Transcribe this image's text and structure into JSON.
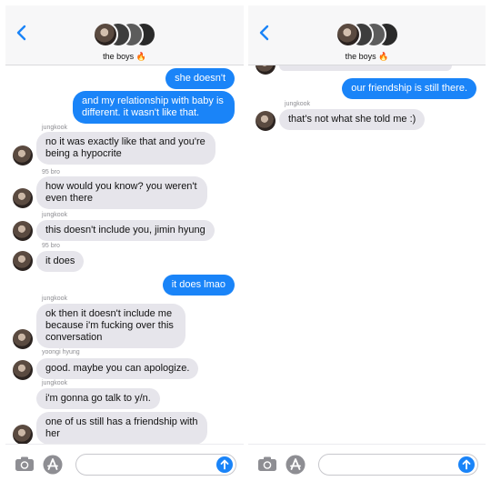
{
  "left": {
    "header": {
      "group_name": "the boys 🔥"
    },
    "messages": [
      {
        "dir": "out",
        "text": "she doesn't"
      },
      {
        "dir": "out",
        "text": "and my relationship with baby is different. it wasn't like that."
      },
      {
        "dir": "in",
        "sender": "jungkook",
        "text": "no it was exactly like that and you're being a hypocrite"
      },
      {
        "dir": "in",
        "sender": "95 bro",
        "text": "how would you know? you weren't even there"
      },
      {
        "dir": "in",
        "sender": "jungkook",
        "text": "this doesn't include you, jimin hyung"
      },
      {
        "dir": "in",
        "sender": "95 bro",
        "text": "it does"
      },
      {
        "dir": "out",
        "text": "it does lmao"
      },
      {
        "dir": "in",
        "sender": "jungkook",
        "text": "ok then it doesn't include me because i'm fucking over this conversation"
      },
      {
        "dir": "in",
        "sender": "yoongi hyung",
        "text": "good. maybe you can apologize."
      },
      {
        "dir": "in",
        "sender": "jungkook",
        "text": "i'm gonna go talk to y/n."
      },
      {
        "dir": "in",
        "text": "one of us still has a friendship with her"
      }
    ]
  },
  "right": {
    "header": {
      "group_name": "the boys 🔥"
    },
    "messages": [
      {
        "dir": "out",
        "text": "our friendship is still there."
      },
      {
        "dir": "in",
        "sender": "jungkook",
        "text": "that's not what she told me :)"
      }
    ]
  },
  "icons": {
    "back": "chevron-left-icon",
    "camera": "camera-icon",
    "apps": "app-store-icon",
    "send": "arrow-up-icon"
  },
  "colors": {
    "accent": "#1a84f8",
    "incoming": "#e6e5eb",
    "header": "#f7f7f8"
  }
}
